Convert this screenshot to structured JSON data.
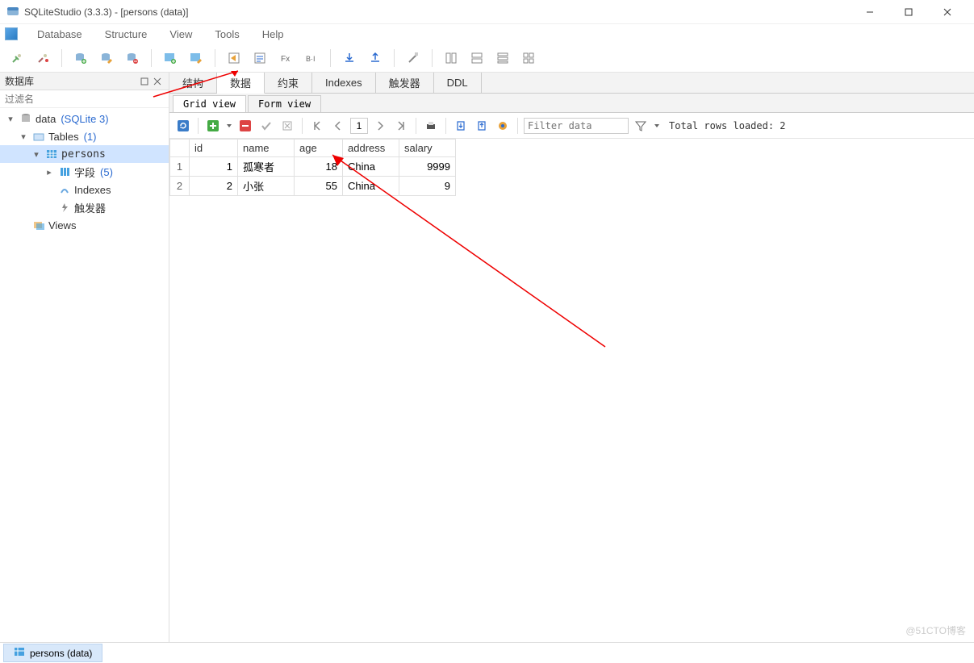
{
  "window": {
    "title": "SQLiteStudio (3.3.3) - [persons (data)]"
  },
  "menu": {
    "items": [
      "Database",
      "Structure",
      "View",
      "Tools",
      "Help"
    ]
  },
  "sidebar": {
    "title": "数据库",
    "filter_placeholder": "过滤名",
    "db_name": "data",
    "db_driver": "(SQLite 3)",
    "tables_label": "Tables",
    "tables_count": "(1)",
    "table_name": "persons",
    "fields_label": "字段",
    "fields_count": "(5)",
    "indexes_label": "Indexes",
    "triggers_label": "触发器",
    "views_label": "Views"
  },
  "tabs": {
    "items": [
      "结构",
      "数据",
      "约束",
      "Indexes",
      "触发器",
      "DDL"
    ],
    "active_index": 1
  },
  "subtabs": {
    "items": [
      "Grid view",
      "Form view"
    ],
    "active_index": 0
  },
  "data_toolbar": {
    "page_value": "1",
    "filter_placeholder": "Filter data",
    "status": "Total rows loaded: 2"
  },
  "grid": {
    "columns": [
      "id",
      "name",
      "age",
      "address",
      "salary"
    ],
    "rows": [
      {
        "n": "1",
        "id": "1",
        "name": "孤寒者",
        "age": "18",
        "address": "China",
        "salary": "9999"
      },
      {
        "n": "2",
        "id": "2",
        "name": "小张",
        "age": "55",
        "address": "China",
        "salary": "9"
      }
    ]
  },
  "statusbar": {
    "doc_label": "persons (data)"
  },
  "watermark": "@51CTO博客"
}
